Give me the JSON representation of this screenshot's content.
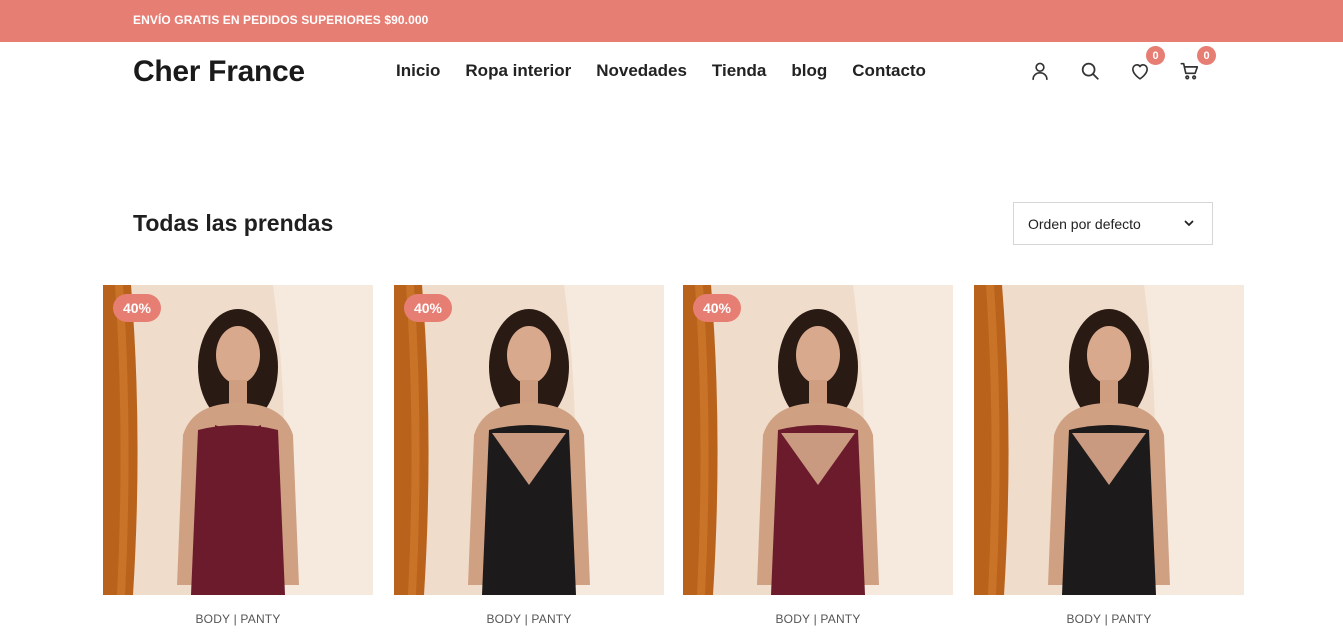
{
  "announcement": "ENVÍO GRATIS EN PEDIDOS SUPERIORES $90.000",
  "brand": "Cher France",
  "nav": [
    "Inicio",
    "Ropa interior",
    "Novedades",
    "Tienda",
    "blog",
    "Contacto"
  ],
  "header_icons": {
    "account": "user-icon",
    "search": "search-icon",
    "wishlist": {
      "icon": "heart-icon",
      "count": "0"
    },
    "cart": {
      "icon": "cart-icon",
      "count": "0"
    }
  },
  "section": {
    "title": "Todas las prendas",
    "sort_value": "Orden por defecto"
  },
  "products": [
    {
      "badge": "40%",
      "category": "BODY | PANTY",
      "garment": "wine-high-neck"
    },
    {
      "badge": "40%",
      "category": "BODY | PANTY",
      "garment": "black-v-neck"
    },
    {
      "badge": "40%",
      "category": "BODY | PANTY",
      "garment": "wine-v-neck"
    },
    {
      "badge": "",
      "category": "BODY | PANTY",
      "garment": "black-v-neck"
    }
  ],
  "colors": {
    "accent": "#e77e74",
    "text": "#222222",
    "wine": "#6b1b2c",
    "black": "#1c1a1b",
    "curtain": "#b8621c",
    "backdrop": "#efdccb"
  }
}
